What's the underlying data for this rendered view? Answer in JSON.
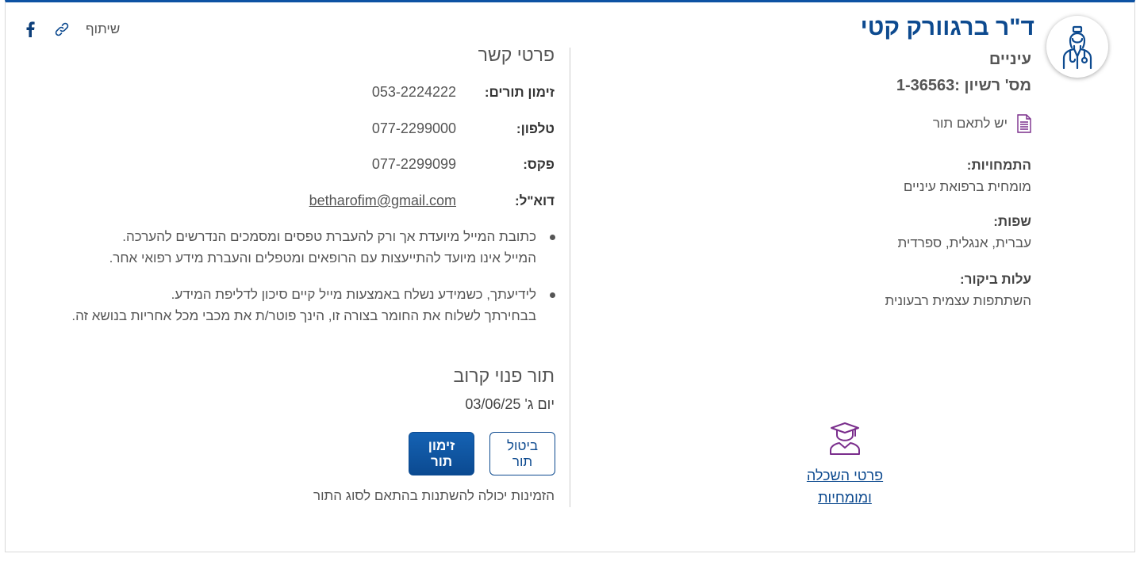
{
  "doctor": {
    "name": "ד\"ר ברגוורק קטי",
    "specialty": "עיניים",
    "license": "מס' רשיון :1-36563",
    "appointment_note": "יש לתאם תור",
    "avatar_icon": "doctor-avatar-icon",
    "fields": [
      {
        "title": "התמחויות:",
        "value": "מומחית ברפואת עיניים"
      },
      {
        "title": "שפות:",
        "value": "עברית, אנגלית, ספרדית"
      },
      {
        "title": "עלות ביקור:",
        "value": "השתתפות עצמית רבעונית"
      }
    ],
    "education_link_line1": "פרטי השכלה",
    "education_link_line2": "ומומחיות",
    "education_icon": "graduation-icon"
  },
  "contact": {
    "title": "פרטי קשר",
    "rows": [
      {
        "label": "זימון תורים:",
        "value": "053-2224222"
      },
      {
        "label": "טלפון:",
        "value": "077-2299000"
      },
      {
        "label": "פקס:",
        "value": "077-2299099"
      },
      {
        "label": "דוא\"ל:",
        "value": "betharofim@gmail.com"
      }
    ],
    "notes": [
      {
        "line1": "כתובת המייל מיועדת אך ורק להעברת טפסים ומסמכים הנדרשים להערכה.",
        "line2": "המייל אינו מיועד להתייעצות עם הרופאים ומטפלים והעברת מידע רפואי אחר."
      },
      {
        "line1": "לידיעתך, כשמידע נשלח באמצעות מייל קיים סיכון לדליפת המידע.",
        "line2": "בבחירתך לשלוח את החומר בצורה זו, הינך פוטר/ת את מכבי מכל אחריות בנושא זה."
      }
    ]
  },
  "next_appointment": {
    "title": "תור פנוי קרוב",
    "date": "יום ג' 03/06/25",
    "cancel_label_line1": "ביטול",
    "cancel_label_line2": "תור",
    "book_label_line1": "זימון",
    "book_label_line2": "תור",
    "availability_note": "הזמינות יכולה להשתנות בהתאם לסוג התור"
  },
  "share": {
    "label": "שיתוף",
    "link_icon": "link-icon",
    "facebook_icon": "facebook-icon"
  },
  "colors": {
    "primary": "#0d4a8f",
    "accent_purple": "#7a2e8c",
    "top_border": "#0d52a3"
  }
}
